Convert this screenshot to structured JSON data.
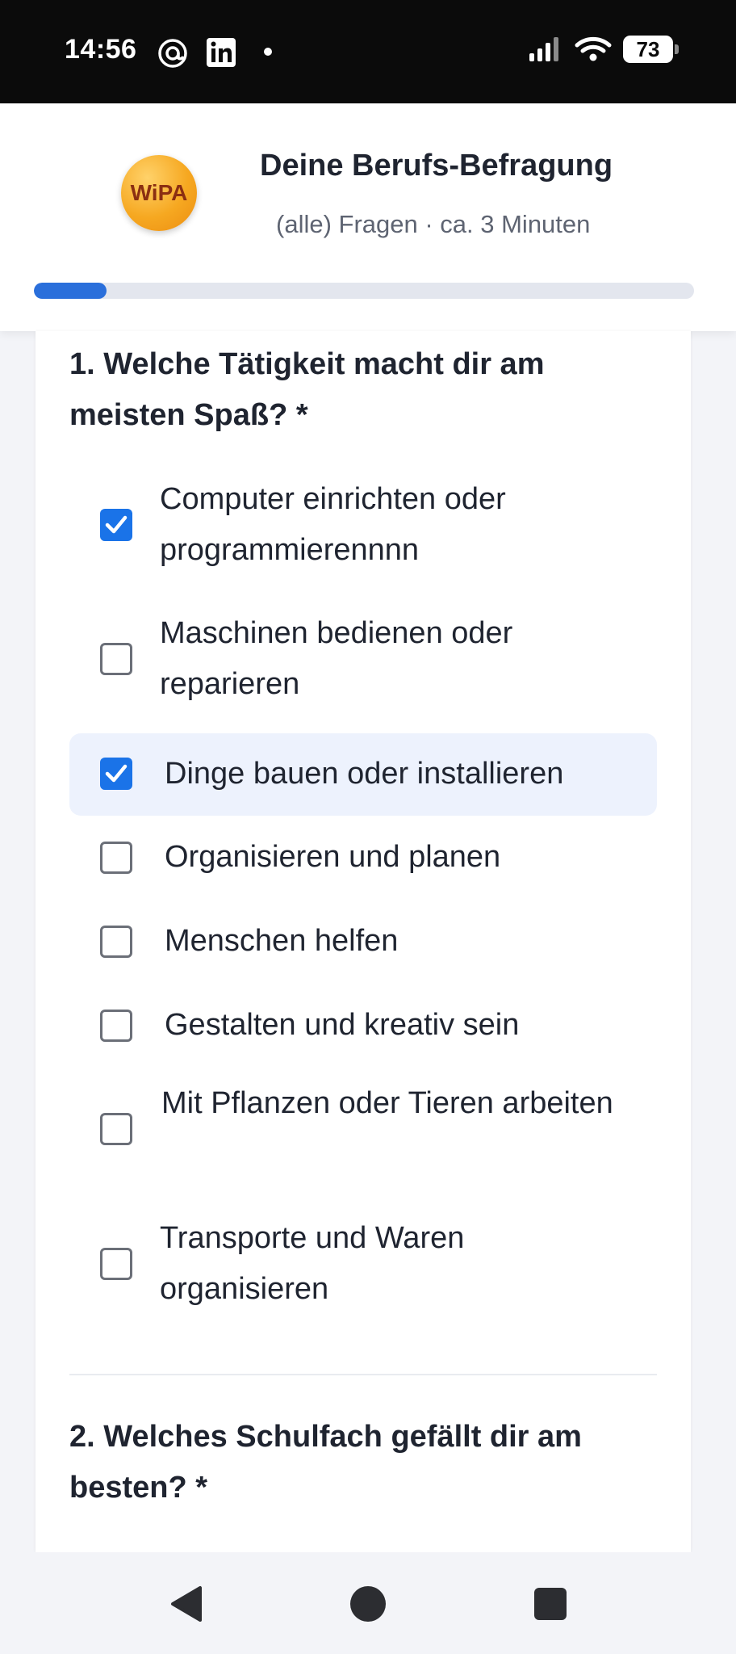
{
  "status_bar": {
    "time": "14:56",
    "battery": "73",
    "icons": [
      "threads-icon",
      "linkedin-icon",
      "dot-icon",
      "signal-icon",
      "wifi-icon",
      "battery-icon"
    ]
  },
  "header": {
    "logo_text": "WiPA",
    "title": "Deine Berufs-Befragung",
    "subtitle": "(alle) Fragen · ca. 3 Minuten",
    "progress": 0.11,
    "accent_color": "#2a6fdb"
  },
  "questions": [
    {
      "title": "1. Welche Tätigkeit macht dir am meisten Spaß? *",
      "options": [
        {
          "label": "Computer einrichten oder programmierennnn",
          "checked": true
        },
        {
          "label": "Maschinen bedienen oder reparieren",
          "checked": false
        },
        {
          "label": "Dinge bauen oder installieren",
          "checked": true,
          "highlighted": true
        },
        {
          "label": "Organisieren und planen",
          "checked": false
        },
        {
          "label": "Menschen helfen",
          "checked": false
        },
        {
          "label": "Gestalten und kreativ sein",
          "checked": false
        },
        {
          "label": "Mit Pflanzen oder Tieren arbeiten",
          "checked": false
        },
        {
          "label": "Transporte und Waren organisieren",
          "checked": false
        }
      ]
    },
    {
      "title": "2. Welches Schulfach gefällt dir am besten? *"
    }
  ],
  "nav": {
    "icons": [
      "back-icon",
      "home-icon",
      "recents-icon"
    ]
  }
}
